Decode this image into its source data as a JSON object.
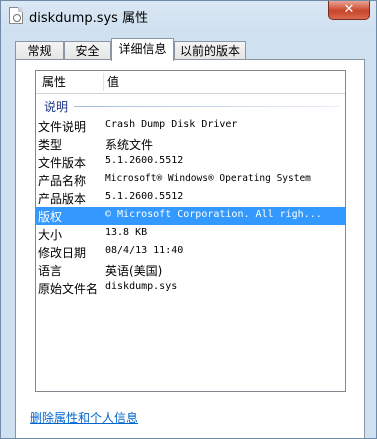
{
  "window": {
    "title": "diskdump.sys 属性",
    "close_label": "✕"
  },
  "tabs": [
    {
      "label": "常规",
      "active": false
    },
    {
      "label": "安全",
      "active": false
    },
    {
      "label": "详细信息",
      "active": true
    },
    {
      "label": "以前的版本",
      "active": false
    }
  ],
  "details": {
    "header": {
      "property": "属性",
      "value": "值"
    },
    "group_label": "说明",
    "rows": [
      {
        "key": "文件说明",
        "value": "Crash Dump Disk Driver"
      },
      {
        "key": "类型",
        "value": "系统文件"
      },
      {
        "key": "文件版本",
        "value": "5.1.2600.5512"
      },
      {
        "key": "产品名称",
        "value": "Microsoft® Windows® Operating System"
      },
      {
        "key": "产品版本",
        "value": "5.1.2600.5512"
      },
      {
        "key": "版权",
        "value": "© Microsoft Corporation. All righ...",
        "selected": true
      },
      {
        "key": "大小",
        "value": "13.8 KB"
      },
      {
        "key": "修改日期",
        "value": "08/4/13 11:40"
      },
      {
        "key": "语言",
        "value": "英语(美国)"
      },
      {
        "key": "原始文件名",
        "value": "diskdump.sys"
      }
    ]
  },
  "remove_link": "删除属性和个人信息",
  "colors": {
    "selection": "#3399ff",
    "link": "#0066cc",
    "group": "#1e3287"
  },
  "icons": {
    "title_icon": "system-file-icon"
  }
}
